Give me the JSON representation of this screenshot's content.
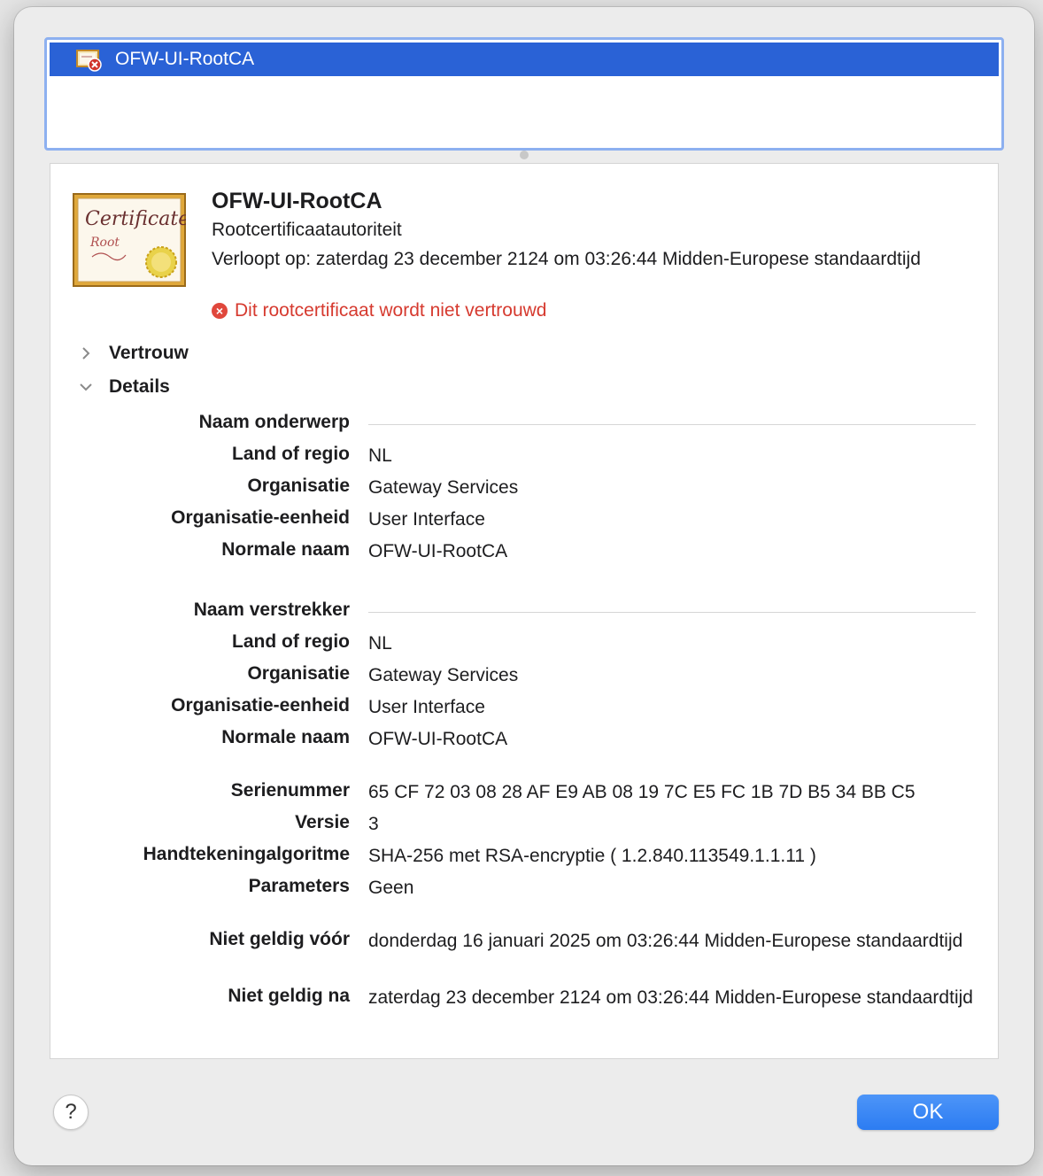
{
  "cert_list": {
    "selected_item": "OFW-UI-RootCA",
    "item_icon": "certificate-error-icon"
  },
  "header": {
    "title": "OFW-UI-RootCA",
    "kind": "Rootcertificaatautoriteit",
    "expiry": "Verloopt op: zaterdag 23 december 2124 om 03:26:44 Midden-Europese standaardtijd",
    "warning": "Dit rootcertificaat wordt niet vertrouwd",
    "warning_color": "#d63a2f",
    "big_icon": "certificate-root-icon",
    "big_icon_text": "Certificate",
    "big_icon_subtext": "Root"
  },
  "sections": {
    "trust": "Vertrouw",
    "details": "Details"
  },
  "subject": {
    "heading": "Naam onderwerp",
    "country_label": "Land of regio",
    "country": "NL",
    "org_label": "Organisatie",
    "org": "Gateway Services",
    "unit_label": "Organisatie-eenheid",
    "unit": "User Interface",
    "cn_label": "Normale naam",
    "cn": "OFW-UI-RootCA"
  },
  "issuer": {
    "heading": "Naam verstrekker",
    "country_label": "Land of regio",
    "country": "NL",
    "org_label": "Organisatie",
    "org": "Gateway Services",
    "unit_label": "Organisatie-eenheid",
    "unit": "User Interface",
    "cn_label": "Normale naam",
    "cn": "OFW-UI-RootCA"
  },
  "meta": {
    "serial_label": "Serienummer",
    "serial": "65 CF 72 03 08 28 AF E9 AB 08 19 7C E5 FC 1B 7D B5 34 BB C5",
    "version_label": "Versie",
    "version": "3",
    "sigalg_label": "Handtekeningalgoritme",
    "sigalg": "SHA-256 met RSA-encryptie ( 1.2.840.113549.1.1.11 )",
    "params_label": "Parameters",
    "params": "Geen"
  },
  "validity": {
    "not_before_label": "Niet geldig vóór",
    "not_before": "donderdag 16 januari 2025 om 03:26:44 Midden-Europese standaardtijd",
    "not_after_label": "Niet geldig na",
    "not_after": "zaterdag 23 december 2124 om 03:26:44 Midden-Europese standaardtijd"
  },
  "buttons": {
    "help": "?",
    "ok": "OK",
    "ok_color": "#2c7cf2"
  }
}
